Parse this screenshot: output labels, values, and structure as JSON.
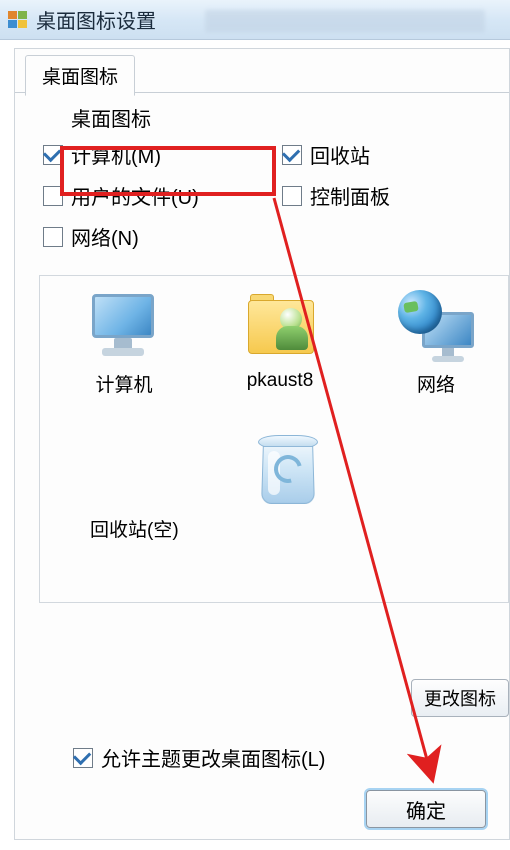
{
  "titlebar": {
    "title": "桌面图标设置"
  },
  "tab": {
    "label": "桌面图标"
  },
  "section": {
    "desktop_icons": "桌面图标"
  },
  "checkboxes": {
    "computer": {
      "label": "计算机(M)",
      "checked": true
    },
    "recycle": {
      "label": "回收站",
      "checked": true
    },
    "userfiles": {
      "label": "用户的文件(U)",
      "checked": false
    },
    "ctrlpanel": {
      "label": "控制面板",
      "checked": false
    },
    "network": {
      "label": "网络(N)",
      "checked": false
    }
  },
  "icon_grid": {
    "computer": "计算机",
    "user": "pkaust8",
    "network": "网络",
    "recycle": "回收站(空)"
  },
  "buttons": {
    "change_icon": "更改图标",
    "ok": "确定"
  },
  "allow_theme": {
    "label": "允许主题更改桌面图标(L)",
    "checked": true
  }
}
